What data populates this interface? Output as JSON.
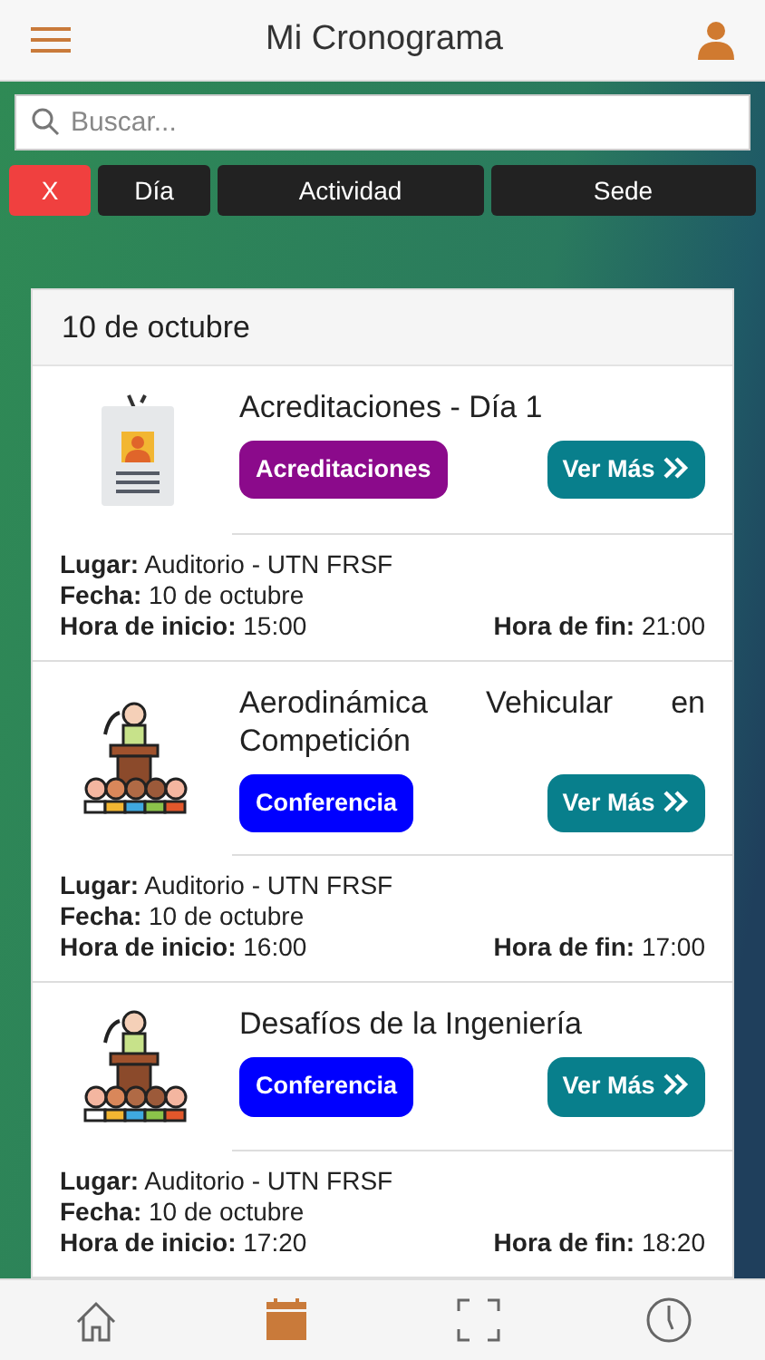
{
  "header": {
    "title": "Mi Cronograma"
  },
  "search": {
    "placeholder": "Buscar..."
  },
  "filters": [
    {
      "label": "X",
      "kind": "clear"
    },
    {
      "label": "Día",
      "kind": "filter"
    },
    {
      "label": "Actividad",
      "kind": "filter"
    },
    {
      "label": "Sede",
      "kind": "filter"
    }
  ],
  "day": {
    "title": "10 de octubre",
    "events": [
      {
        "kind": "badge",
        "title": "Acreditaciones - Día 1",
        "category": "Acreditaciones",
        "color": "#8b0a8b",
        "more": "Ver Más",
        "place_label": "Lugar:",
        "place": "Auditorio - UTN FRSF",
        "date_label": "Fecha:",
        "date": "10 de octubre",
        "start_label": "Hora de inicio:",
        "start": "15:00",
        "end_label": "Hora de fin:",
        "end": "21:00"
      },
      {
        "kind": "speaker",
        "title": "Aerodinámica Vehicular en Competición",
        "category": "Conferencia",
        "color": "#0000ff",
        "more": "Ver Más",
        "place_label": "Lugar:",
        "place": "Auditorio - UTN FRSF",
        "date_label": "Fecha:",
        "date": "10 de octubre",
        "start_label": "Hora de inicio:",
        "start": "16:00",
        "end_label": "Hora de fin:",
        "end": "17:00"
      },
      {
        "kind": "speaker",
        "title": "Desafíos de la Ingeniería",
        "category": "Conferencia",
        "color": "#0000ff",
        "more": "Ver Más",
        "place_label": "Lugar:",
        "place": "Auditorio - UTN FRSF",
        "date_label": "Fecha:",
        "date": "10 de octubre",
        "start_label": "Hora de inicio:",
        "start": "17:20",
        "end_label": "Hora de fin:",
        "end": "18:20"
      }
    ]
  },
  "tab_bar": [
    {
      "kind": "home",
      "selected": false
    },
    {
      "kind": "calendar",
      "selected": true
    },
    {
      "kind": "scan",
      "selected": false
    },
    {
      "kind": "clock",
      "selected": false
    }
  ]
}
